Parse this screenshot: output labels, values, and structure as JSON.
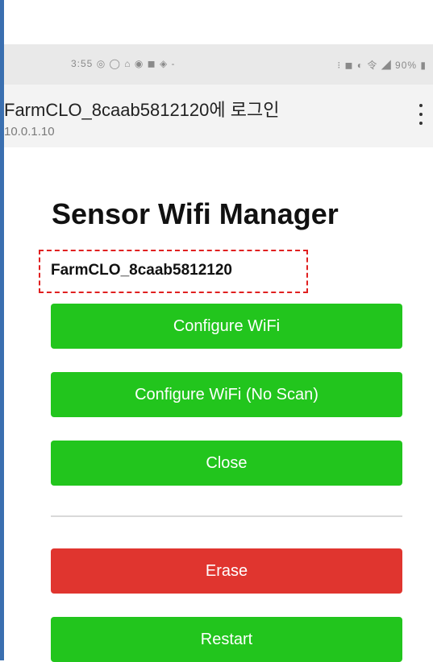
{
  "status_bar": {
    "time_and_icons": "3:55 ◎ ◯ ⌂ ◉ ◼ ◈  -",
    "right_icons": "⁝ ◼ ◐ 令 ◢ 90% ▮"
  },
  "browser": {
    "page_title": "FarmCLO_8caab5812120에 로그인",
    "url": "10.0.1.10"
  },
  "main": {
    "heading": "Sensor Wifi Manager",
    "device_name": "FarmCLO_8caab5812120",
    "buttons": {
      "configure_wifi": "Configure WiFi",
      "configure_wifi_no_scan": "Configure WiFi (No Scan)",
      "close": "Close",
      "erase": "Erase",
      "restart": "Restart"
    }
  },
  "colors": {
    "green": "#22c51d",
    "red": "#e0352f",
    "highlight_border": "#e02020"
  }
}
